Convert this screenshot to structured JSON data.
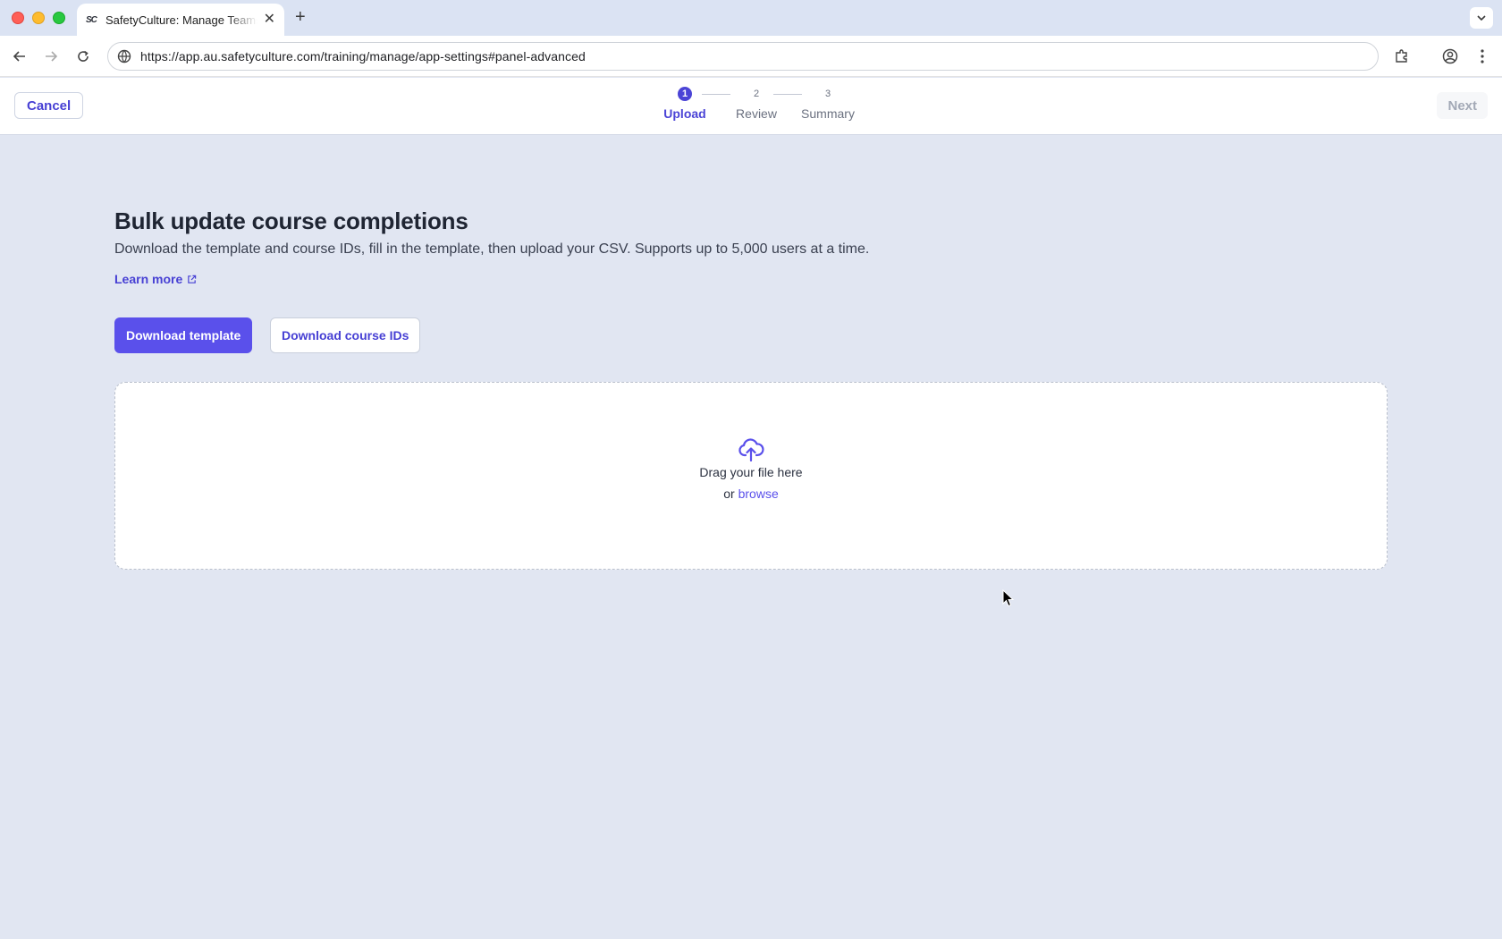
{
  "browser": {
    "tab_title": "SafetyCulture: Manage Teams",
    "tab_favicon": "SC",
    "url": "https://app.au.safetyculture.com/training/manage/app-settings#panel-advanced"
  },
  "header": {
    "cancel_label": "Cancel",
    "next_label": "Next",
    "steps": [
      {
        "number": "1",
        "label": "Upload",
        "active": true
      },
      {
        "number": "2",
        "label": "Review",
        "active": false
      },
      {
        "number": "3",
        "label": "Summary",
        "active": false
      }
    ]
  },
  "main": {
    "title": "Bulk update course completions",
    "description": "Download the template and course IDs, fill in the template, then upload your CSV. Supports up to 5,000 users at a time.",
    "learn_more": "Learn more",
    "download_template": "Download template",
    "download_course_ids": "Download course IDs",
    "dropzone": {
      "icon": "cloud-upload-icon",
      "drag_text": "Drag your file here",
      "or_text": "or",
      "browse_text": "browse"
    }
  },
  "colors": {
    "accent": "#5a50eb",
    "link": "#4740d4",
    "page_bg": "#e1e6f2"
  }
}
